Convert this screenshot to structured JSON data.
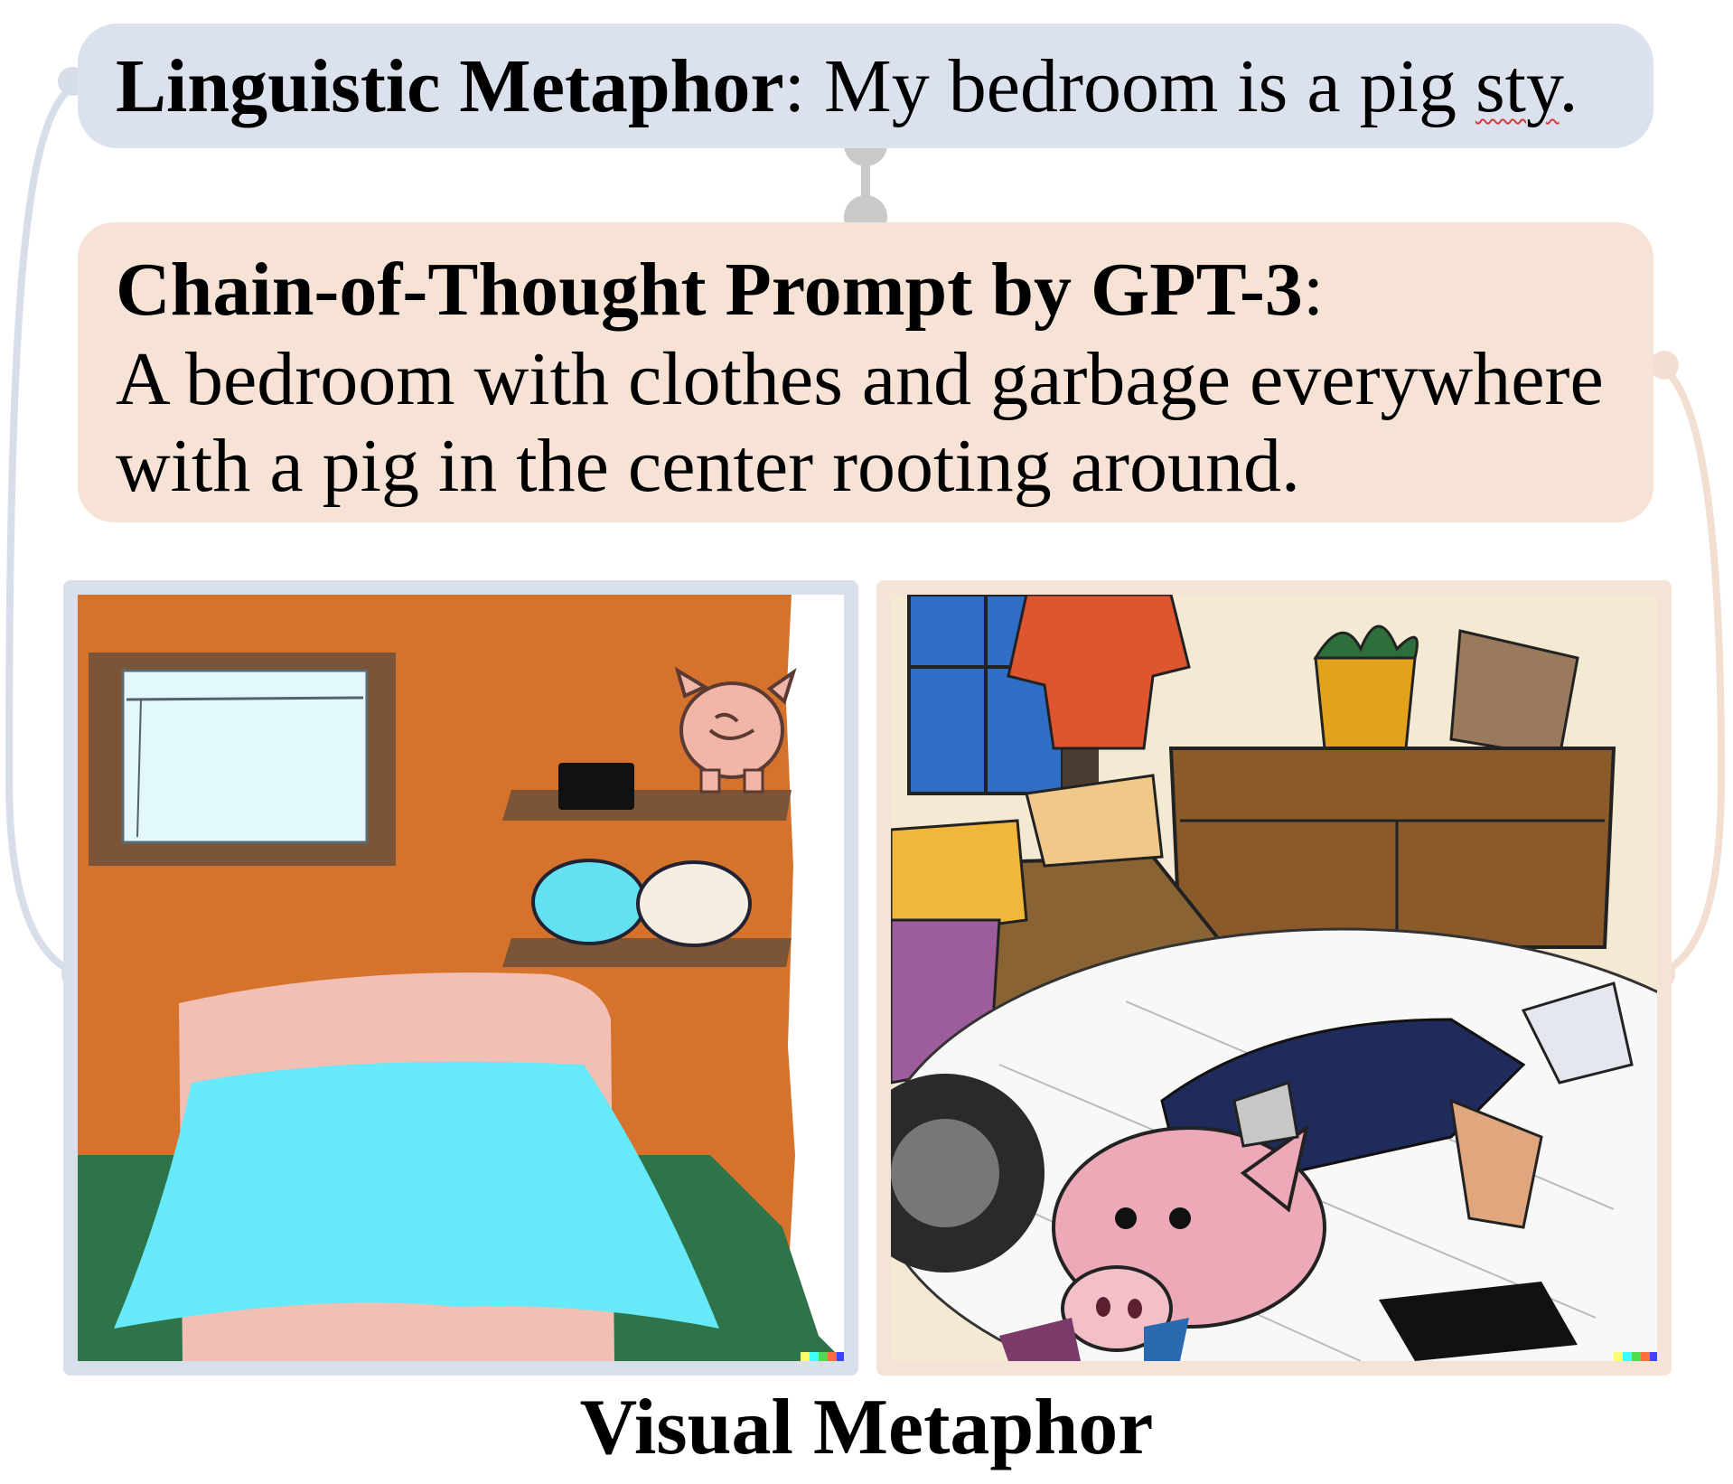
{
  "linguistic_metaphor": {
    "label": "Linguistic Metaphor",
    "separator": ":",
    "sentence_before": " My bedroom is a pig ",
    "sentence_flagged": "sty",
    "sentence_end": "."
  },
  "prompt": {
    "label": "Chain-of-Thought Prompt by GPT-3",
    "separator": ":",
    "line1": "A bedroom with clothes and garbage everywhere",
    "line2": "with a pig in the center rooting around."
  },
  "caption": "Visual Metaphor",
  "colors": {
    "metaphor_box": "#dbe2ee",
    "prompt_box": "#f6e3d6",
    "connector_gray": "#c9c9c9",
    "left_link": "#d7deea",
    "right_link": "#f3dfd1"
  }
}
